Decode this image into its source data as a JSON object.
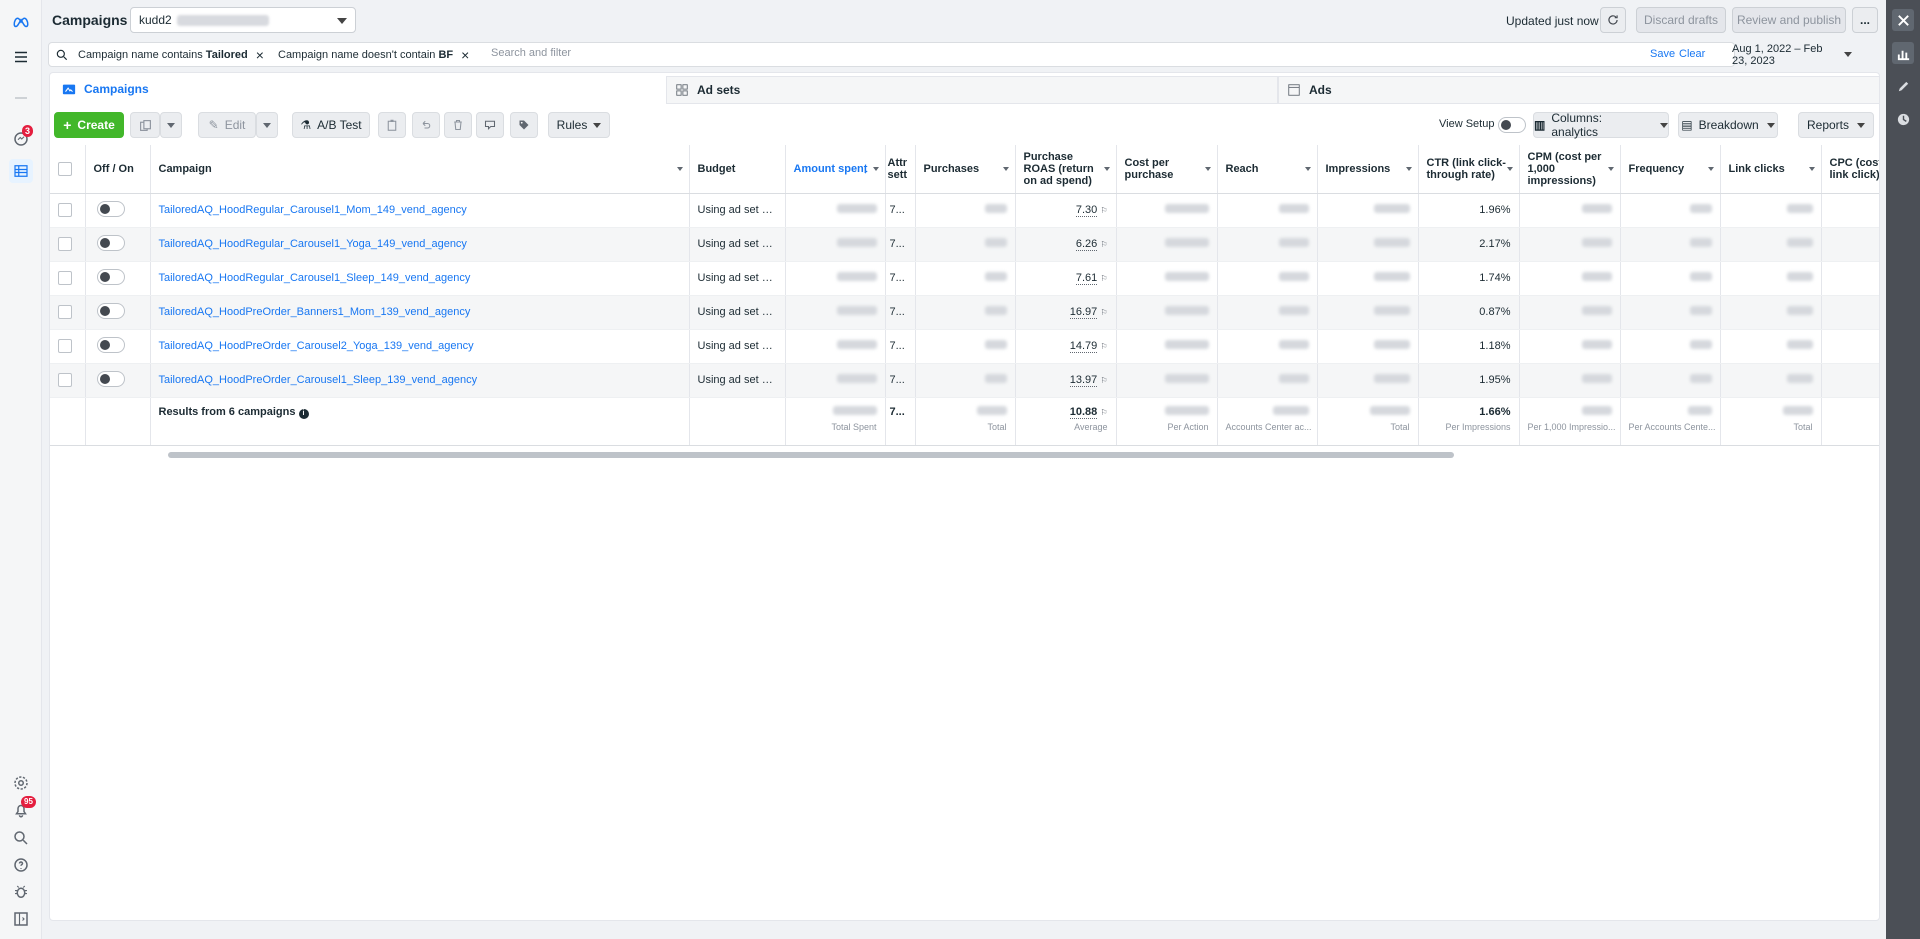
{
  "topbar": {
    "title": "Campaigns",
    "account_prefix": "kudd2",
    "updated": "Updated just now",
    "discard": "Discard drafts",
    "review": "Review and publish",
    "more": "..."
  },
  "filters": {
    "chip1_pre": "Campaign name contains ",
    "chip1_val": "Tailored",
    "chip2_pre": "Campaign name doesn't contain ",
    "chip2_val": "BF",
    "placeholder": "Search and filter",
    "save": "Save",
    "clear": "Clear",
    "date_range": "Aug 1, 2022 – Feb 23, 2023"
  },
  "tabs": {
    "campaigns": "Campaigns",
    "adsets": "Ad sets",
    "ads": "Ads"
  },
  "toolbar": {
    "create": "Create",
    "edit": "Edit",
    "ab_test": "A/B Test",
    "rules": "Rules",
    "view_setup": "View Setup",
    "columns": "Columns: analytics",
    "breakdown": "Breakdown",
    "reports": "Reports"
  },
  "leftnav": {
    "inbox_badge": "3",
    "notif_badge": "95"
  },
  "table": {
    "headers": {
      "onoff": "Off / On",
      "campaign": "Campaign",
      "budget": "Budget",
      "amount_spent": "Amount spent",
      "attribution": "Attr sett",
      "purchases": "Purchases",
      "roas": "Purchase ROAS (return on ad spend)",
      "cost_per_purchase": "Cost per purchase",
      "reach": "Reach",
      "impressions": "Impressions",
      "ctr": "CTR (link click-through rate)",
      "cpm": "CPM (cost per 1,000 impressions)",
      "frequency": "Frequency",
      "link_clicks": "Link clicks",
      "cpc": "CPC (cost per link click)"
    },
    "rows": [
      {
        "name": "TailoredAQ_HoodRegular_Carousel1_Mom_149_vend_agency",
        "budget": "Using ad set bu...",
        "attr": "7...",
        "roas": "7.30",
        "ctr": "1.96%"
      },
      {
        "name": "TailoredAQ_HoodRegular_Carousel1_Yoga_149_vend_agency",
        "budget": "Using ad set bu...",
        "attr": "7...",
        "roas": "6.26",
        "ctr": "2.17%"
      },
      {
        "name": "TailoredAQ_HoodRegular_Carousel1_Sleep_149_vend_agency",
        "budget": "Using ad set bu...",
        "attr": "7...",
        "roas": "7.61",
        "ctr": "1.74%"
      },
      {
        "name": "TailoredAQ_HoodPreOrder_Banners1_Mom_139_vend_agency",
        "budget": "Using ad set bu...",
        "attr": "7...",
        "roas": "16.97",
        "ctr": "0.87%"
      },
      {
        "name": "TailoredAQ_HoodPreOrder_Carousel2_Yoga_139_vend_agency",
        "budget": "Using ad set bu...",
        "attr": "7...",
        "roas": "14.79",
        "ctr": "1.18%"
      },
      {
        "name": "TailoredAQ_HoodPreOrder_Carousel1_Sleep_139_vend_agency",
        "budget": "Using ad set bu...",
        "attr": "7...",
        "roas": "13.97",
        "ctr": "1.95%"
      }
    ],
    "totals": {
      "label": "Results from 6 campaigns",
      "attr": "7...",
      "roas": "10.88",
      "ctr": "1.66%",
      "sub_spent": "Total Spent",
      "sub_purchases": "Total",
      "sub_roas": "Average",
      "sub_cpp": "Per Action",
      "sub_reach": "Accounts Center ac...",
      "sub_impr": "Total",
      "sub_ctr": "Per Impressions",
      "sub_cpm": "Per 1,000 Impressio...",
      "sub_freq": "Per Accounts Cente...",
      "sub_clicks": "Total",
      "sub_cpc": "Pe"
    }
  }
}
